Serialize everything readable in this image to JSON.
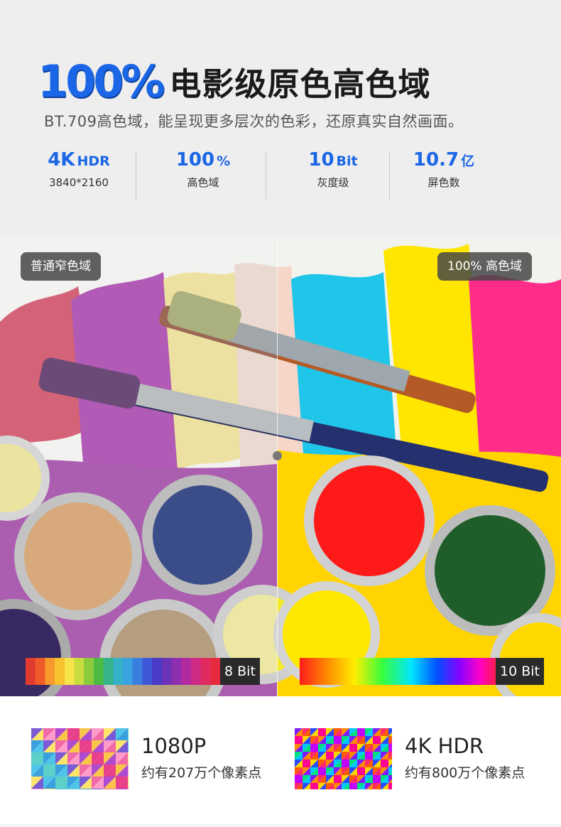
{
  "header": {
    "percent": "100%",
    "title": "电影级原色高色域",
    "subtitle": "BT.709高色域，能呈现更多层次的色彩，还原真实自然画面。"
  },
  "stats": [
    {
      "value": "4K",
      "unit": "HDR",
      "label": "3840*2160"
    },
    {
      "value": "100",
      "unit": "%",
      "label": "高色域"
    },
    {
      "value": "10",
      "unit": "Bit",
      "label": "灰度级"
    },
    {
      "value": "10.7",
      "unit": "亿",
      "label": "屏色数"
    }
  ],
  "compare": {
    "left_badge": "普通窄色域",
    "right_badge": "100% 高色域",
    "left_bit": "8 Bit",
    "right_bit": "10 Bit"
  },
  "resolution": [
    {
      "title": "1080P",
      "subtitle": "约有207万个像素点"
    },
    {
      "title": "4K HDR",
      "subtitle": "约有800万个像素点"
    }
  ],
  "colors": {
    "accent": "#1a66e6",
    "header_bg": "#eeeeee",
    "badge_bg": "#464646"
  }
}
